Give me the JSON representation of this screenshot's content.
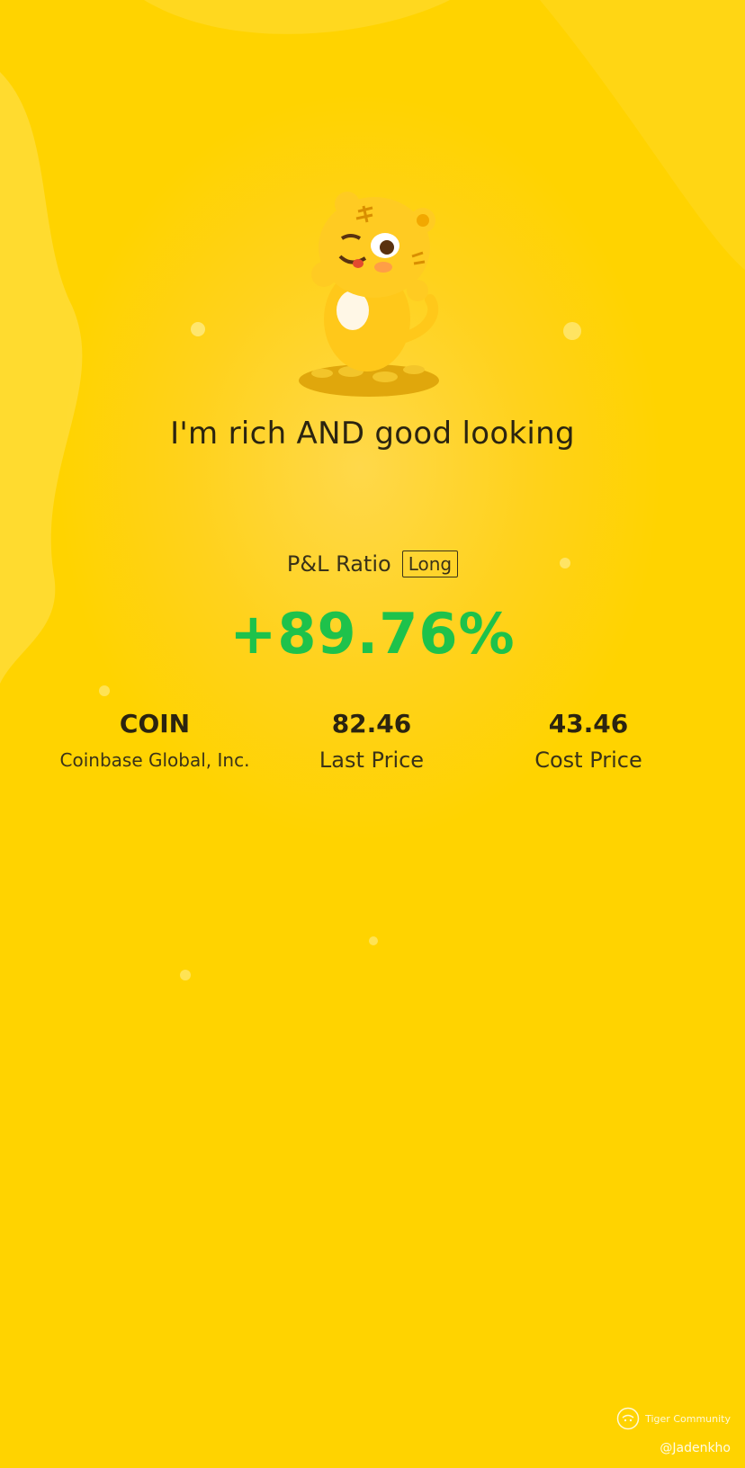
{
  "headline": "I'm rich AND good looking",
  "pl": {
    "label": "P&L Ratio",
    "position_badge": "Long",
    "value": "+89.76%"
  },
  "stats": {
    "symbol": "COIN",
    "company": "Coinbase Global, Inc.",
    "last_price_value": "82.46",
    "last_price_label": "Last Price",
    "cost_price_value": "43.46",
    "cost_price_label": "Cost Price"
  },
  "footer": {
    "brand": "Tiger Community",
    "handle": "@Jadenkho"
  },
  "icons": {
    "mascot": "tiger-mascot-icon",
    "brand_logo": "tiger-logo-icon"
  },
  "colors": {
    "background": "#ffd400",
    "gain": "#1ec24b",
    "text": "#2b2410"
  }
}
